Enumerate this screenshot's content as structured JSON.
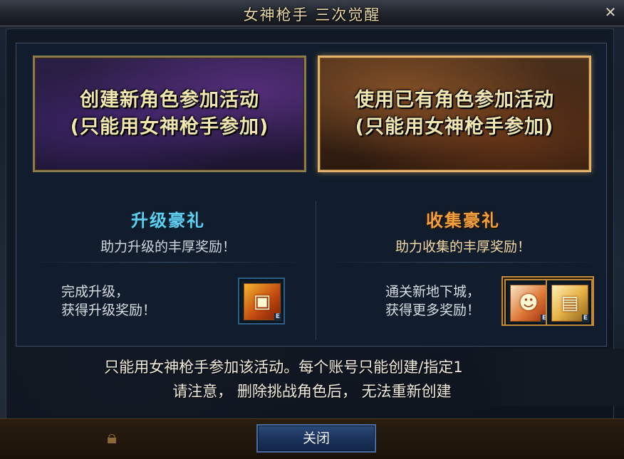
{
  "window": {
    "title": "女神枪手 三次觉醒",
    "close_glyph": "✕"
  },
  "cards": {
    "new_character": {
      "line1": "创建新角色参加活动",
      "line2": "(只能用女神枪手参加)"
    },
    "existing_character": {
      "line1": "使用已有角色参加活动",
      "line2": "(只能用女神枪手参加)"
    }
  },
  "rewards": {
    "levelup": {
      "title": "升级豪礼",
      "subtitle": "助力升级的丰厚奖励！",
      "desc_line1": "完成升级，",
      "desc_line2": "获得升级奖励！",
      "item_tag": "E",
      "icon": "treasure-box-icon"
    },
    "collect": {
      "title": "收集豪礼",
      "subtitle": "助力收集的丰厚奖励！",
      "desc_line1": "通关新地下城，",
      "desc_line2": "获得更多奖励！",
      "item_tag_1": "E",
      "item_tag_2": "E",
      "icon_1": "character-reward-icon",
      "icon_2": "golden-chest-icon"
    }
  },
  "notice": {
    "line1": "只能用女神枪手参加该活动。每个账号只能创建/指定1",
    "line2": "请注意， 删除挑战角色后， 无法重新创建"
  },
  "footer": {
    "close_label": "关闭",
    "lock_icon": "lock-icon"
  },
  "colors": {
    "levelup_title": "#5fd0f0",
    "collect_title": "#f0a040",
    "card_text": "#f1e6b0",
    "button_bg": "#1a3158"
  }
}
